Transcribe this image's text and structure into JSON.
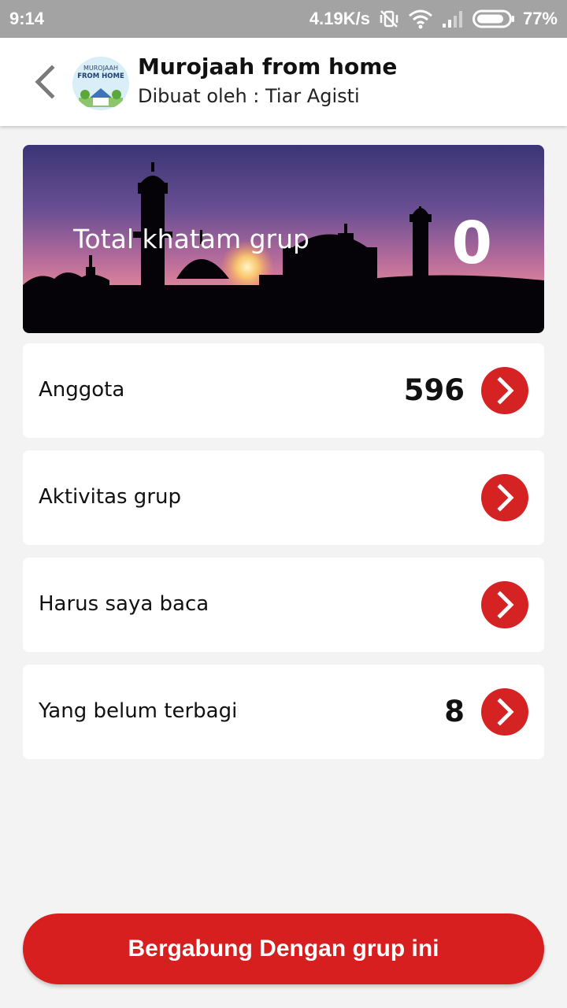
{
  "status_bar": {
    "time": "9:14",
    "network_speed": "4.19K/s",
    "battery": "77%"
  },
  "header": {
    "title": "Murojaah from home",
    "subtitle": "Dibuat oleh : Tiar Agisti",
    "logo_text_top": "MUROJAAH",
    "logo_text_bottom": "FROM HOME"
  },
  "banner": {
    "label": "Total khatam grup",
    "value": "0"
  },
  "items": [
    {
      "label": "Anggota",
      "count": "596"
    },
    {
      "label": "Aktivitas grup",
      "count": ""
    },
    {
      "label": "Harus saya baca",
      "count": ""
    },
    {
      "label": "Yang belum terbagi",
      "count": "8"
    }
  ],
  "join_button": {
    "label": "Bergabung Dengan grup ini"
  },
  "colors": {
    "accent": "#d52222",
    "background": "#f3f3f3",
    "status_bar": "#a3a3a3"
  },
  "icons": {
    "back": "chevron-left-icon",
    "item_action": "chevron-right-icon"
  }
}
